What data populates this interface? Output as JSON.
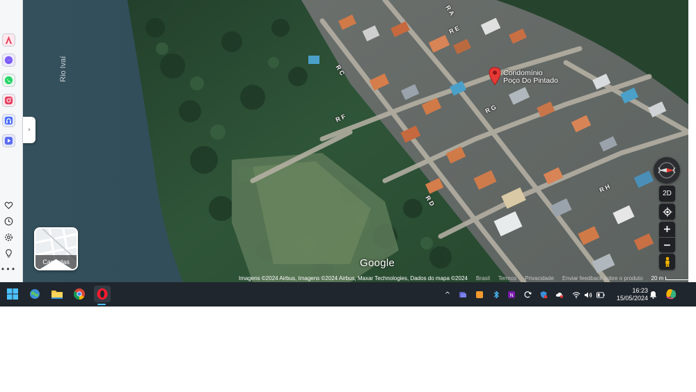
{
  "sidebar": {
    "apps": [
      {
        "name": "aria",
        "glyph": "A",
        "color": "#e8455f"
      },
      {
        "name": "messenger",
        "glyph": "m",
        "color": "#7b5cf5"
      },
      {
        "name": "whatsapp",
        "glyph": "w",
        "color": "#25d366"
      },
      {
        "name": "instagram",
        "glyph": "◎",
        "color": "#e4405f"
      },
      {
        "name": "music",
        "glyph": "♪",
        "color": "#4a6cf7"
      },
      {
        "name": "player",
        "glyph": "▶",
        "color": "#5b6cf0"
      }
    ],
    "collapse_glyph": "›"
  },
  "map": {
    "river_label": "Rio Ivaí",
    "streets": [
      {
        "text": "R A"
      },
      {
        "text": "R C"
      },
      {
        "text": "R E"
      },
      {
        "text": "R F"
      },
      {
        "text": "R G"
      },
      {
        "text": "R D"
      },
      {
        "text": "R H"
      }
    ],
    "place": {
      "line1": "Condomínio",
      "line2": "Poço Do Pintado"
    },
    "layers_label": "Camadas",
    "logo": "Google",
    "attribution": "Imagens ©2024 Airbus, Imagens ©2024 Airbus, Maxar Technologies, Dados do mapa ©2024",
    "links": [
      "Brasil",
      "Termos",
      "Privacidade",
      "Enviar feedback sobre o produto"
    ],
    "scale": "20 m",
    "controls": {
      "mode": "2D",
      "zoom_in": "+",
      "zoom_out": "−"
    }
  },
  "taskbar": {
    "tray_arrow": "^",
    "time": "16:23",
    "date": "15/05/2024"
  },
  "colors": {
    "taskbar": "#20262d",
    "pin": "#e53935",
    "accent": "#4cc2ff"
  }
}
